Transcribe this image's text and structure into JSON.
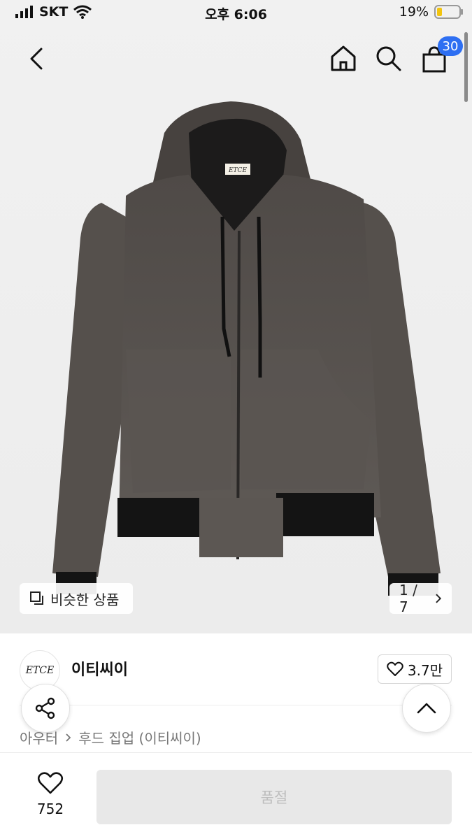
{
  "status_bar": {
    "carrier": "SKT",
    "time": "오후 6:06",
    "battery": "19%"
  },
  "nav": {
    "back_icon": "chevron-left-icon",
    "home_icon": "home-icon",
    "search_icon": "search-icon",
    "cart_icon": "cart-icon",
    "cart_count": "30"
  },
  "gallery": {
    "similar_label": "비슷한 상품",
    "page_indicator": "1 / 7",
    "product_logo_text": "ETCE"
  },
  "brand": {
    "logo_text": "ETCE",
    "name": "이티씨이",
    "likes": "3.7만"
  },
  "breadcrumb": {
    "category": "아우터",
    "subcategory": "후드 집업 (이티씨이)"
  },
  "bottom_bar": {
    "wish_count": "752",
    "buy_label": "품절"
  },
  "colors": {
    "badge": "#2e6ff2",
    "jacket": "#57524f",
    "sold_out_bg": "#e8e8e8"
  }
}
